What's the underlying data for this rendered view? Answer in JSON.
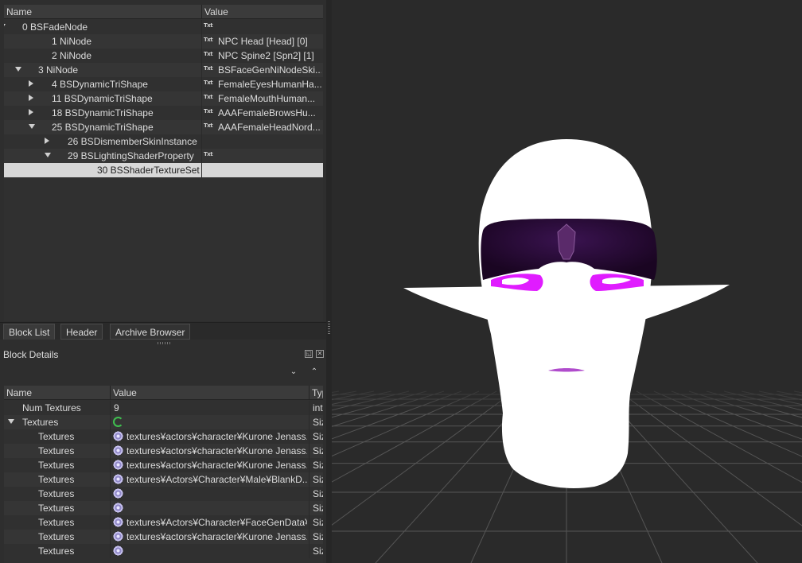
{
  "block_list": {
    "columns": [
      "Name",
      "Value"
    ],
    "rows": [
      {
        "name": "0 BSFadeNode",
        "value": "",
        "txt": true
      },
      {
        "name": "1 NiNode",
        "value": "NPC Head [Head] [0]",
        "txt": true
      },
      {
        "name": "2 NiNode",
        "value": "NPC Spine2 [Spn2] [1]",
        "txt": true
      },
      {
        "name": "3 NiNode",
        "value": "BSFaceGenNiNodeSki...",
        "txt": true
      },
      {
        "name": "4 BSDynamicTriShape",
        "value": "FemaleEyesHumanHa...",
        "txt": true
      },
      {
        "name": "11 BSDynamicTriShape",
        "value": "FemaleMouthHuman...",
        "txt": true
      },
      {
        "name": "18 BSDynamicTriShape",
        "value": "AAAFemaleBrowsHu...",
        "txt": true
      },
      {
        "name": "25 BSDynamicTriShape",
        "value": "AAAFemaleHeadNord...",
        "txt": true
      },
      {
        "name": "26 BSDismemberSkinInstance",
        "value": "",
        "txt": false
      },
      {
        "name": "29 BSLightingShaderProperty",
        "value": "",
        "txt": true
      },
      {
        "name": "30 BSShaderTextureSet",
        "value": "",
        "txt": false
      }
    ]
  },
  "tabs": [
    "Block List",
    "Header",
    "Archive Browser"
  ],
  "block_details": {
    "title": "Block Details",
    "columns": [
      "Name",
      "Value",
      "Typ"
    ],
    "rows": [
      {
        "name": "Num Textures",
        "value": "9",
        "type": "int",
        "icon": "none"
      },
      {
        "name": "Textures",
        "value": "",
        "type": "Siz",
        "icon": "refresh"
      },
      {
        "name": "Textures",
        "value": "textures¥actors¥character¥Kurone Jenass...",
        "type": "Siz",
        "icon": "gear"
      },
      {
        "name": "Textures",
        "value": "textures¥actors¥character¥Kurone Jenass...",
        "type": "Siz",
        "icon": "gear"
      },
      {
        "name": "Textures",
        "value": "textures¥actors¥character¥Kurone Jenass...",
        "type": "Siz",
        "icon": "gear"
      },
      {
        "name": "Textures",
        "value": "textures¥Actors¥Character¥Male¥BlankD...",
        "type": "Siz",
        "icon": "gear"
      },
      {
        "name": "Textures",
        "value": "",
        "type": "Siz",
        "icon": "gear"
      },
      {
        "name": "Textures",
        "value": "",
        "type": "Siz",
        "icon": "gear"
      },
      {
        "name": "Textures",
        "value": "textures¥Actors¥Character¥FaceGenData¥...",
        "type": "Siz",
        "icon": "gear"
      },
      {
        "name": "Textures",
        "value": "textures¥actors¥character¥Kurone Jenass...",
        "type": "Siz",
        "icon": "gear"
      },
      {
        "name": "Textures",
        "value": "",
        "type": "Siz",
        "icon": "gear"
      }
    ]
  },
  "txt_icon_label": "Txt",
  "colors": {
    "selection": "#d7d7d7",
    "magenta_texture": "#e01cff",
    "dark_purple_texture": "#2a0a3a"
  }
}
